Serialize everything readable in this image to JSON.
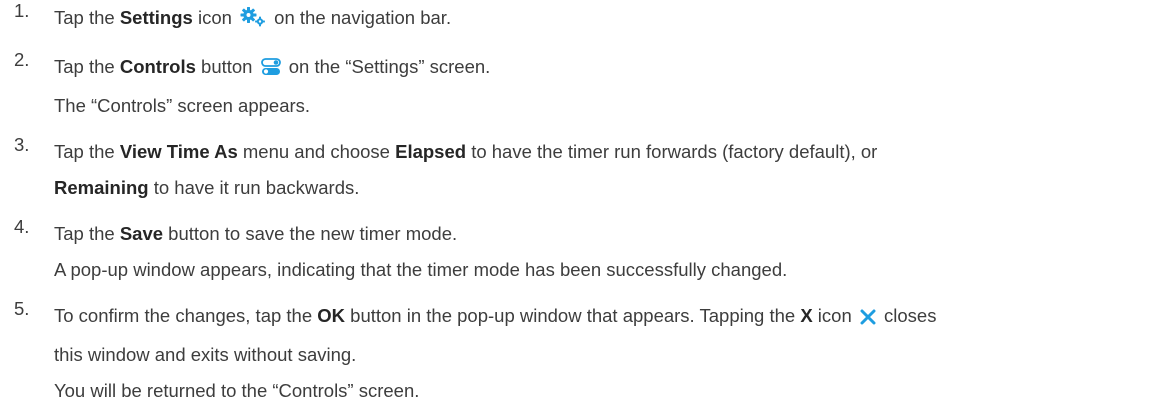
{
  "steps": [
    {
      "num": "1.",
      "p1": "Tap the ",
      "b1": "Settings",
      "p2": " icon",
      "p3": " on the navigation bar."
    },
    {
      "num": "2.",
      "p1": "Tap the ",
      "b1": "Controls",
      "p2": " button",
      "p3": " on the “Settings” screen.",
      "note": "The “Controls” screen appears."
    },
    {
      "num": "3.",
      "p1": "Tap the ",
      "b1": "View Time As",
      "p2": " menu and choose ",
      "b2": "Elapsed",
      "p3": " to have the timer run forwards (factory default), or",
      "b3": "Remaining",
      "p4": " to have it run backwards."
    },
    {
      "num": "4.",
      "p1": "Tap the ",
      "b1": "Save",
      "p2": " button to save the new timer mode.",
      "note": "A pop-up window appears, indicating that the timer mode has been successfully changed."
    },
    {
      "num": "5.",
      "p1": "To confirm the changes, tap the ",
      "b1": "OK",
      "p2": " button in the pop-up window that appears. Tapping the ",
      "b2": "X",
      "p3": " icon",
      "p4": " closes",
      "p5": "this window and exits without saving.",
      "note": "You will be returned to the “Controls” screen."
    }
  ],
  "icons": {
    "settings": "gear-icon",
    "controls": "toggle-switch-icon",
    "close": "close-icon",
    "accent_color": "#1e9de0"
  }
}
